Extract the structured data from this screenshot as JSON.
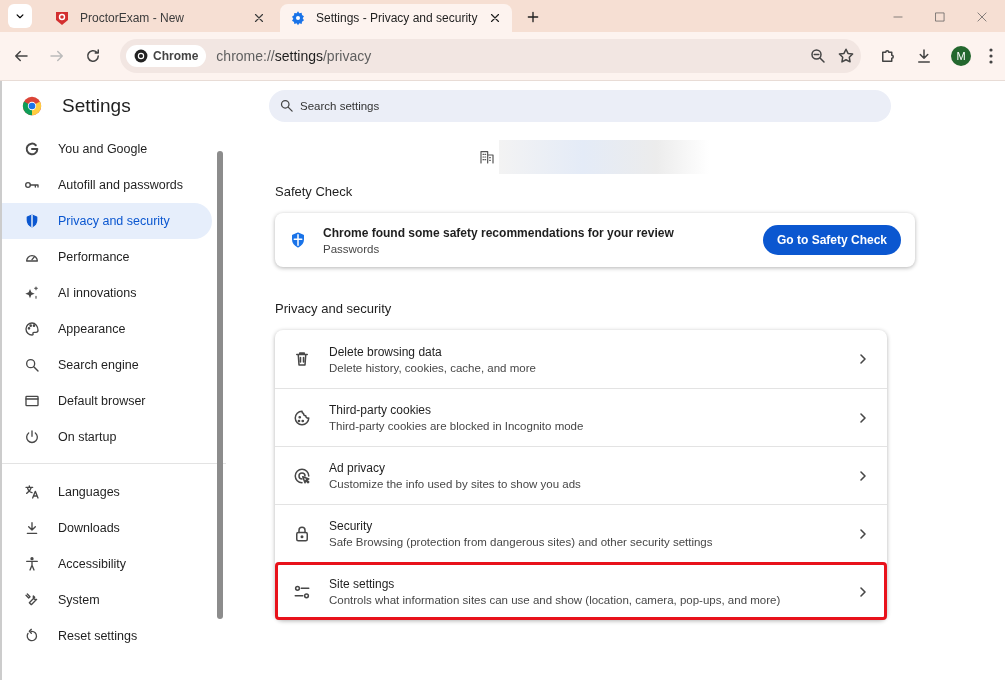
{
  "tabs": [
    {
      "title": "ProctorExam - New",
      "selected": false
    },
    {
      "title": "Settings - Privacy and security",
      "selected": true
    }
  ],
  "toolbar": {
    "chip": "Chrome",
    "url_host": "chrome://",
    "url_path": "settings",
    "url_rest": "/privacy",
    "avatar": "M"
  },
  "sidebar": {
    "title": "Settings",
    "groups": [
      [
        {
          "label": "You and Google",
          "selected": false
        },
        {
          "label": "Autofill and passwords",
          "selected": false
        },
        {
          "label": "Privacy and security",
          "selected": true
        },
        {
          "label": "Performance",
          "selected": false
        },
        {
          "label": "AI innovations",
          "selected": false
        },
        {
          "label": "Appearance",
          "selected": false
        },
        {
          "label": "Search engine",
          "selected": false
        },
        {
          "label": "Default browser",
          "selected": false
        },
        {
          "label": "On startup",
          "selected": false
        }
      ],
      [
        {
          "label": "Languages",
          "selected": false
        },
        {
          "label": "Downloads",
          "selected": false
        },
        {
          "label": "Accessibility",
          "selected": false
        },
        {
          "label": "System",
          "selected": false
        },
        {
          "label": "Reset settings",
          "selected": false
        }
      ]
    ]
  },
  "search": {
    "placeholder": "Search settings"
  },
  "safety_check": {
    "heading": "Safety Check",
    "title": "Chrome found some safety recommendations for your review",
    "subtitle": "Passwords",
    "button": "Go to Safety Check"
  },
  "privacy": {
    "heading": "Privacy and security",
    "rows": [
      {
        "title": "Delete browsing data",
        "subtitle": "Delete history, cookies, cache, and more",
        "highlighted": false
      },
      {
        "title": "Third-party cookies",
        "subtitle": "Third-party cookies are blocked in Incognito mode",
        "highlighted": false
      },
      {
        "title": "Ad privacy",
        "subtitle": "Customize the info used by sites to show you ads",
        "highlighted": false
      },
      {
        "title": "Security",
        "subtitle": "Safe Browsing (protection from dangerous sites) and other security settings",
        "highlighted": false
      },
      {
        "title": "Site settings",
        "subtitle": "Controls what information sites can use and show (location, camera, pop-ups, and more)",
        "highlighted": true
      }
    ]
  }
}
